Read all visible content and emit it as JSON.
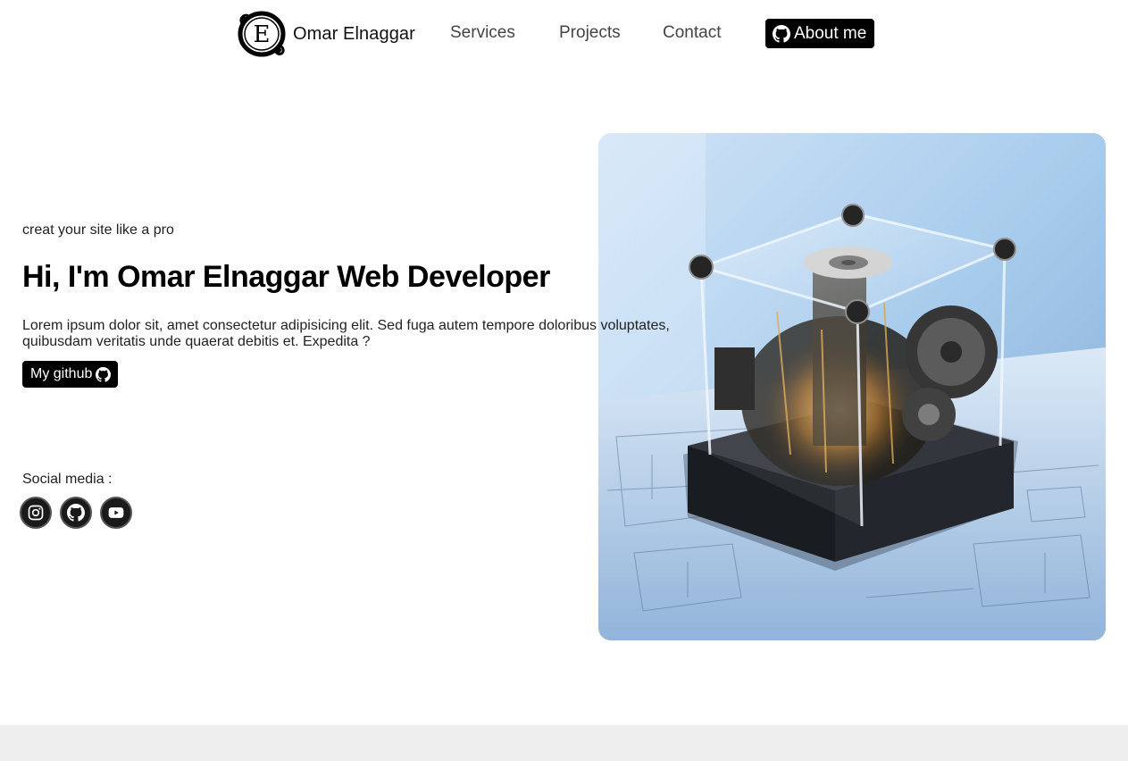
{
  "nav": {
    "brand_name": "Omar Elnaggar",
    "logo_letter": "E",
    "links": [
      "Services",
      "Projects",
      "Contact"
    ],
    "about_label": "About me"
  },
  "hero": {
    "tagline": "creat your site like a pro",
    "title": "Hi, I'm Omar Elnaggar Web Developer",
    "description": "Lorem ipsum dolor sit, amet consectetur adipisicing elit. Sed fuga autem tempore doloribus voluptates, quibusdam veritatis unde quaerat debitis et. Expedita ?",
    "github_label": "My github",
    "social_label": "Social media :",
    "socials": [
      "instagram-icon",
      "github-icon",
      "youtube-icon"
    ],
    "image": "transparent-cube-machine-on-blueprint"
  },
  "colors": {
    "accent": "#000000",
    "text": "#222222",
    "footer_band": "#eeeeee",
    "image_blue": "#a9cdee"
  }
}
